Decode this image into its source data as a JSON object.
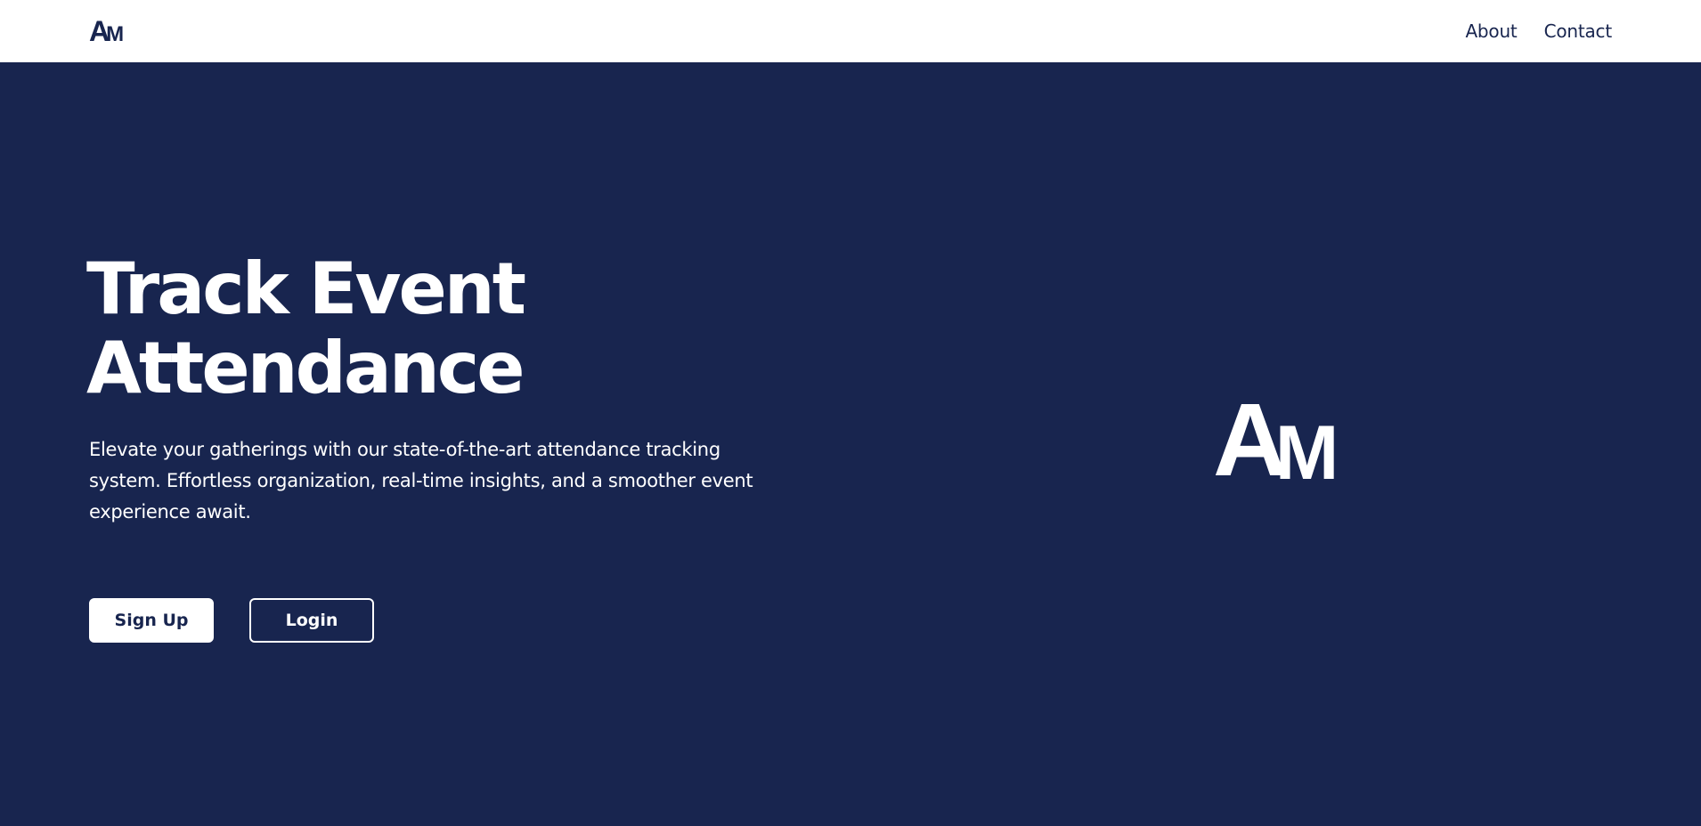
{
  "header": {
    "logo_a": "A",
    "logo_m": "M",
    "nav": [
      {
        "label": "About"
      },
      {
        "label": "Contact"
      }
    ]
  },
  "hero": {
    "title_line1": "Track Event",
    "title_line2": "Attendance",
    "description": "Elevate your gatherings with our state-of-the-art attendance tracking system. Effortless organization, real-time insights, and a smoother event experience await.",
    "signup_label": "Sign Up",
    "login_label": "Login",
    "logo_a": "A",
    "logo_m": "M"
  },
  "colors": {
    "brand_navy": "#18254f",
    "white": "#ffffff"
  }
}
